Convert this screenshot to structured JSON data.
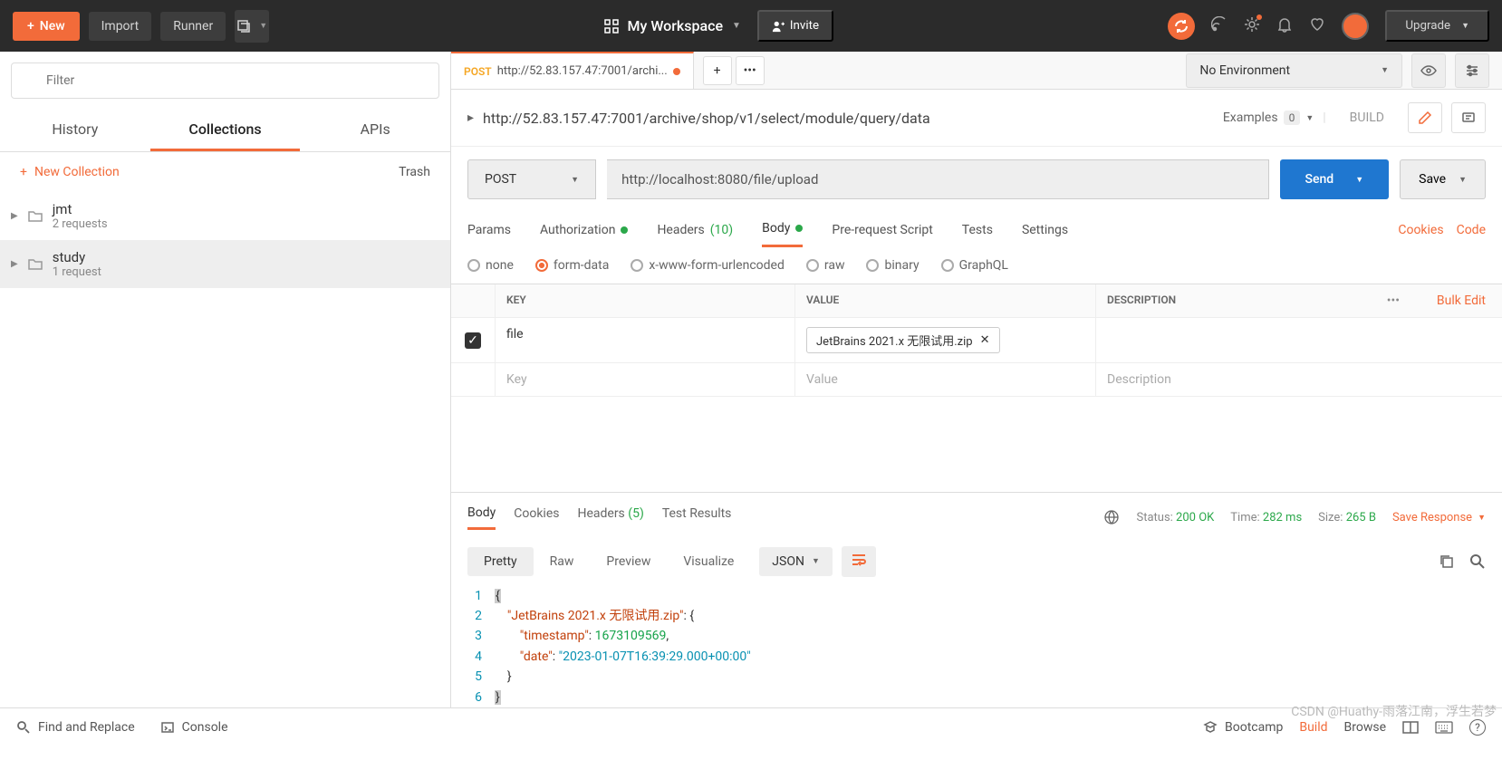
{
  "header": {
    "new": "New",
    "import": "Import",
    "runner": "Runner",
    "workspace": "My Workspace",
    "invite": "Invite",
    "upgrade": "Upgrade"
  },
  "sidebar": {
    "filter_placeholder": "Filter",
    "tabs": {
      "history": "History",
      "collections": "Collections",
      "apis": "APIs"
    },
    "new_collection": "New Collection",
    "trash": "Trash",
    "collections": [
      {
        "name": "jmt",
        "count": "2 requests"
      },
      {
        "name": "study",
        "count": "1 request"
      }
    ]
  },
  "tabbar": {
    "method": "POST",
    "title": "http://52.83.157.47:7001/archi..."
  },
  "environment": "No Environment",
  "request": {
    "title": "http://52.83.157.47:7001/archive/shop/v1/select/module/query/data",
    "examples": "Examples",
    "examples_count": "0",
    "build": "BUILD",
    "method": "POST",
    "url": "http://localhost:8080/file/upload",
    "send": "Send",
    "save": "Save",
    "tabs": {
      "params": "Params",
      "auth": "Authorization",
      "headers": "Headers",
      "headers_count": "(10)",
      "body": "Body",
      "prerequest": "Pre-request Script",
      "tests": "Tests",
      "settings": "Settings"
    },
    "links": {
      "cookies": "Cookies",
      "code": "Code"
    },
    "body_types": [
      "none",
      "form-data",
      "x-www-form-urlencoded",
      "raw",
      "binary",
      "GraphQL"
    ],
    "table": {
      "key_h": "KEY",
      "val_h": "VALUE",
      "desc_h": "DESCRIPTION",
      "bulk": "Bulk Edit",
      "rows": [
        {
          "key": "file",
          "value": "JetBrains 2021.x 无限试用.zip"
        }
      ],
      "key_ph": "Key",
      "val_ph": "Value",
      "desc_ph": "Description"
    }
  },
  "response": {
    "tabs": {
      "body": "Body",
      "cookies": "Cookies",
      "headers": "Headers",
      "headers_count": "(5)",
      "tests": "Test Results"
    },
    "status_label": "Status:",
    "status": "200 OK",
    "time_label": "Time:",
    "time": "282 ms",
    "size_label": "Size:",
    "size": "265 B",
    "save": "Save Response",
    "view_tabs": {
      "pretty": "Pretty",
      "raw": "Raw",
      "preview": "Preview",
      "visualize": "Visualize"
    },
    "format": "JSON",
    "json": {
      "l1": "{",
      "l2_key": "\"JetBrains 2021.x 无限试用.zip\"",
      "l2_rest": ": {",
      "l3_key": "\"timestamp\"",
      "l3_val": "1673109569",
      "l4_key": "\"date\"",
      "l4_val": "\"2023-01-07T16:39:29.000+00:00\"",
      "l5": "}",
      "l6": "}"
    }
  },
  "footer": {
    "find": "Find and Replace",
    "console": "Console",
    "bootcamp": "Bootcamp",
    "build": "Build",
    "browse": "Browse"
  },
  "watermark": "CSDN @Huathy-雨落江南，浮生若梦"
}
